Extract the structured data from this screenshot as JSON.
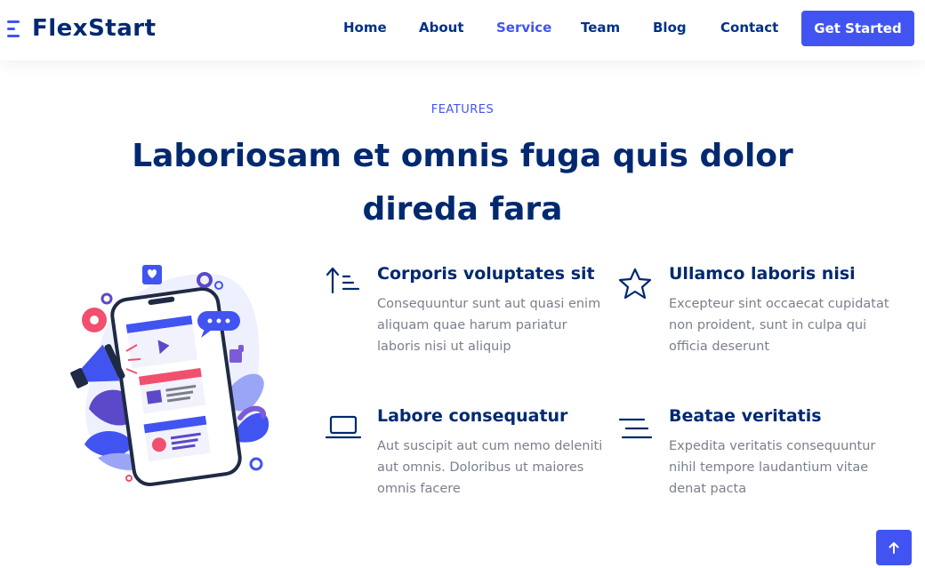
{
  "brand": {
    "name": "FlexStart"
  },
  "nav": {
    "items": [
      {
        "label": "Home"
      },
      {
        "label": "About"
      },
      {
        "label": "Service"
      },
      {
        "label": "Team"
      },
      {
        "label": "Blog"
      },
      {
        "label": "Contact"
      }
    ],
    "active": "Service",
    "cta_label": "Get Started"
  },
  "section": {
    "tag": "FEATURES",
    "title": "Laboriosam et omnis fuga quis dolor direda fara"
  },
  "features": [
    {
      "icon": "sort-up-icon",
      "title": "Corporis voluptates sit",
      "text": "Consequuntur sunt aut quasi enim aliquam quae harum pariatur laboris nisi ut aliquip"
    },
    {
      "icon": "star-icon",
      "title": "Ullamco laboris nisi",
      "text": "Excepteur sint occaecat cupidatat non proident, sunt in culpa qui officia deserunt"
    },
    {
      "icon": "laptop-icon",
      "title": "Labore consequatur",
      "text": "Aut suscipit aut cum nemo deleniti aut omnis. Doloribus ut maiores omnis facere"
    },
    {
      "icon": "text-align-icon",
      "title": "Beatae veritatis",
      "text": "Expedita veritatis consequuntur nihil tempore laudantium vitae denat pacta"
    }
  ],
  "colors": {
    "primary": "#4154f1",
    "heading": "#012970",
    "text": "#7a7f8c",
    "accent": "#f0506e"
  },
  "back_to_top": {
    "icon": "arrow-up-icon"
  }
}
